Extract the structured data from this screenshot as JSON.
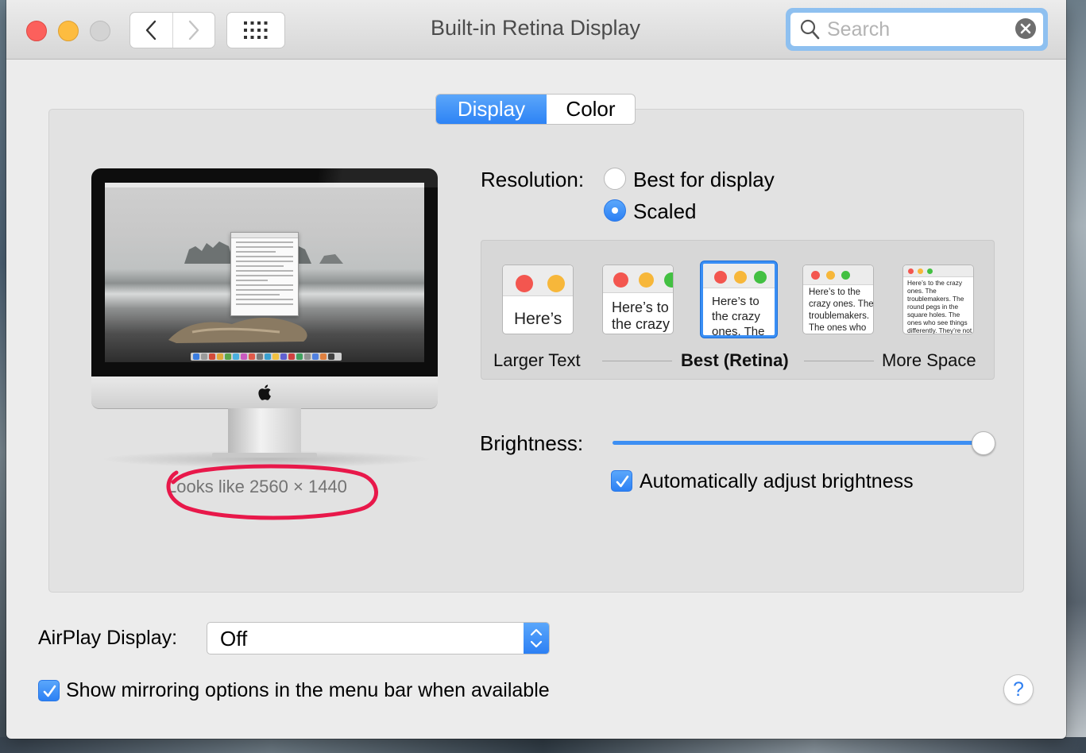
{
  "window": {
    "title": "Built-in Retina Display"
  },
  "search": {
    "placeholder": "Search"
  },
  "tabs": [
    {
      "label": "Display",
      "selected": true
    },
    {
      "label": "Color",
      "selected": false
    }
  ],
  "display_preview": {
    "looks_like": "Looks like 2560 × 1440"
  },
  "resolution": {
    "label": "Resolution:",
    "options": [
      {
        "label": "Best for display",
        "selected": false
      },
      {
        "label": "Scaled",
        "selected": true
      }
    ]
  },
  "scaling": {
    "thumb_texts": [
      "Here’s",
      "Here’s to the crazy ones. The troublemakers.",
      "Here’s to the crazy ones. The troublemakers. The ones who see things",
      "Here’s to the crazy ones. The troublemakers. The ones who see things differently. They’re not fond of rules. And they",
      "Here’s to the crazy ones. The troublemakers. The round pegs in the square holes. The ones who see things differently. They’re not fond of rules. And they have no respect for the status quo. You can quote them, disagree with them, glorify or vilify them. About the only thing you can’t do is ignore them. Because they change things."
    ],
    "selected_index": 2,
    "label_left": "Larger Text",
    "label_center": "Best (Retina)",
    "label_right": "More Space"
  },
  "brightness": {
    "label": "Brightness:",
    "level": 1.0,
    "auto_label": "Automatically adjust brightness",
    "auto_checked": true
  },
  "airplay": {
    "label": "AirPlay Display:",
    "value": "Off"
  },
  "mirroring": {
    "label": "Show mirroring options in the menu bar when available",
    "checked": true
  },
  "help": {
    "label": "?"
  },
  "colors": {
    "accent": "#2f85f5",
    "annotation": "#e8184a"
  }
}
